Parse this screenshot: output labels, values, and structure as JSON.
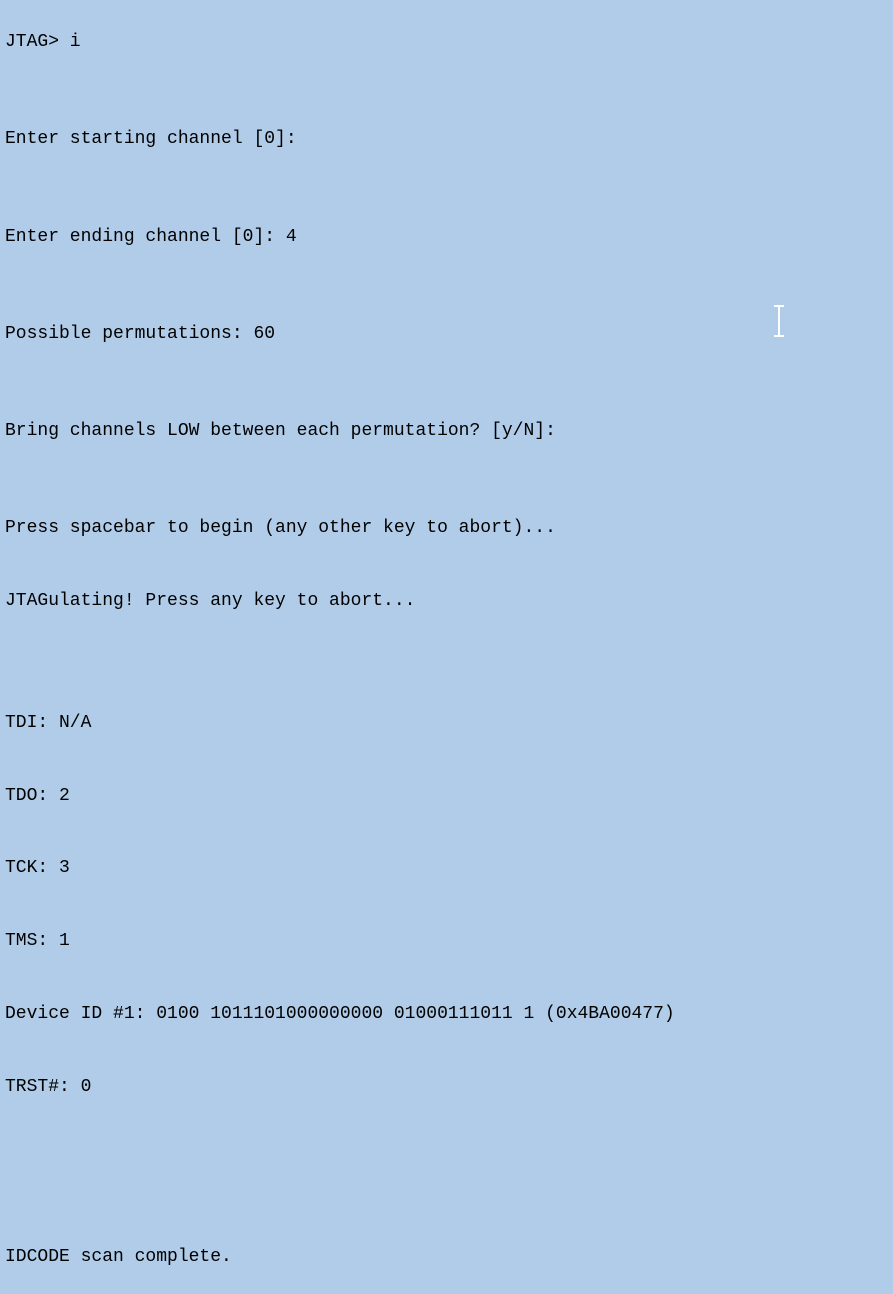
{
  "terminal": {
    "lines": [
      "JTAG> i",
      "",
      "",
      "Enter starting channel [0]:",
      "",
      "",
      "Enter ending channel [0]: 4",
      "",
      "",
      "Possible permutations: 60",
      "",
      "",
      "Bring channels LOW between each permutation? [y/N]:",
      "",
      "",
      "Press spacebar to begin (any other key to abort)...",
      "",
      "JTAGulating! Press any key to abort...",
      "",
      "",
      "",
      "TDI: N/A",
      "",
      "TDO: 2",
      "",
      "TCK: 3",
      "",
      "TMS: 1",
      "",
      "Device ID #1: 0100 1011101000000000 01000111011 1 (0x4BA00477)",
      "",
      "TRST#: 0",
      "",
      "",
      "",
      "",
      "",
      "IDCODE scan complete."
    ],
    "prompt": "JTAG>",
    "command": "i",
    "starting_channel": "0",
    "ending_channel_default": "0",
    "ending_channel_input": "4",
    "permutations": "60",
    "pins": {
      "TDI": "N/A",
      "TDO": "2",
      "TCK": "3",
      "TMS": "1",
      "TRST": "0"
    },
    "device_id": {
      "index": "1",
      "binary": "0100 1011101000000000 01000111011 1",
      "hex": "0x4BA00477"
    }
  }
}
